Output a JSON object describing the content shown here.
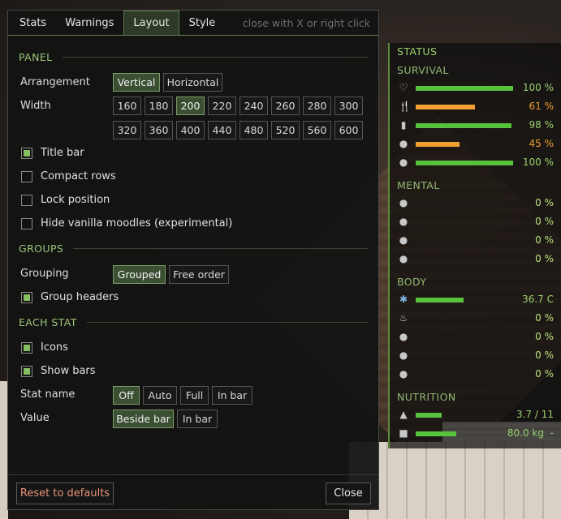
{
  "colors": {
    "accent_green": "#9bd06e",
    "bar_green": "#57c23c",
    "bar_orange": "#f0a030",
    "warn_orange": "#f0a030",
    "reset_red": "#e8937a",
    "zero_green": "#b8e07a"
  },
  "tabs": {
    "stats": "Stats",
    "warnings": "Warnings",
    "layout": "Layout",
    "style": "Style",
    "hint": "close with X or right click",
    "active": "Layout"
  },
  "panel": {
    "section": "PANEL",
    "arrangement_label": "Arrangement",
    "arrangement_options": [
      "Vertical",
      "Horizontal"
    ],
    "arrangement_selected": "Vertical",
    "width_label": "Width",
    "width_options": [
      "160",
      "180",
      "200",
      "220",
      "240",
      "260",
      "280",
      "300",
      "320",
      "360",
      "400",
      "440",
      "480",
      "520",
      "560",
      "600"
    ],
    "width_selected": "200",
    "title_bar": {
      "label": "Title bar",
      "checked": true
    },
    "compact_rows": {
      "label": "Compact rows",
      "checked": false
    },
    "lock_position": {
      "label": "Lock position",
      "checked": false
    },
    "hide_vanilla": {
      "label": "Hide vanilla moodles (experimental)",
      "checked": false
    }
  },
  "groups": {
    "section": "GROUPS",
    "grouping_label": "Grouping",
    "grouping_options": [
      "Grouped",
      "Free order"
    ],
    "grouping_selected": "Grouped",
    "group_headers": {
      "label": "Group headers",
      "checked": true
    }
  },
  "each_stat": {
    "section": "EACH STAT",
    "icons": {
      "label": "Icons",
      "checked": true
    },
    "show_bars": {
      "label": "Show bars",
      "checked": true
    },
    "stat_name_label": "Stat name",
    "stat_name_options": [
      "Off",
      "Auto",
      "Full",
      "In bar"
    ],
    "stat_name_selected": "Off",
    "value_label": "Value",
    "value_options": [
      "Beside bar",
      "In bar"
    ],
    "value_selected": "Beside bar"
  },
  "footer": {
    "reset": "Reset to defaults",
    "close": "Close"
  },
  "status": {
    "title": "STATUS",
    "survival": {
      "label": "SURVIVAL",
      "rows": [
        {
          "icon": "heart-icon",
          "glyph": "♡",
          "value": "100 %",
          "fill": 1.0,
          "color": "#57c23c",
          "text_color": "#9bd06e"
        },
        {
          "icon": "fork-knife-icon",
          "glyph": "🍴",
          "value": "61 %",
          "fill": 0.61,
          "color": "#f0a030",
          "text_color": "#f0a030"
        },
        {
          "icon": "water-glass-icon",
          "glyph": "▮",
          "value": "98 %",
          "fill": 0.98,
          "color": "#57c23c",
          "text_color": "#9bd06e"
        },
        {
          "icon": "tired-face-icon",
          "glyph": "●",
          "value": "45 %",
          "fill": 0.45,
          "color": "#f0a030",
          "text_color": "#f0a030"
        },
        {
          "icon": "brain-icon",
          "glyph": "●",
          "value": "100 %",
          "fill": 1.0,
          "color": "#57c23c",
          "text_color": "#9bd06e"
        }
      ]
    },
    "mental": {
      "label": "MENTAL",
      "rows": [
        {
          "icon": "angry-face-icon",
          "glyph": "●",
          "value": "0 %",
          "fill": 0,
          "color": "#57c23c",
          "text_color": "#b8e07a"
        },
        {
          "icon": "scared-face-icon",
          "glyph": "●",
          "value": "0 %",
          "fill": 0,
          "color": "#57c23c",
          "text_color": "#b8e07a"
        },
        {
          "icon": "bored-face-icon",
          "glyph": "●",
          "value": "0 %",
          "fill": 0,
          "color": "#57c23c",
          "text_color": "#b8e07a"
        },
        {
          "icon": "sad-face-icon",
          "glyph": "●",
          "value": "0 %",
          "fill": 0,
          "color": "#57c23c",
          "text_color": "#b8e07a"
        }
      ]
    },
    "body": {
      "label": "BODY",
      "rows": [
        {
          "icon": "snowflake-icon",
          "glyph": "✱",
          "value": "36.7 C",
          "fill": 0.49,
          "color": "#57c23c",
          "text_color": "#9bd06e"
        },
        {
          "icon": "wet-icon",
          "glyph": "♨",
          "value": "0 %",
          "fill": 0,
          "color": "#57c23c",
          "text_color": "#b8e07a"
        },
        {
          "icon": "sick-face-icon",
          "glyph": "●",
          "value": "0 %",
          "fill": 0,
          "color": "#57c23c",
          "text_color": "#b8e07a"
        },
        {
          "icon": "pain-face-icon",
          "glyph": "●",
          "value": "0 %",
          "fill": 0,
          "color": "#57c23c",
          "text_color": "#b8e07a"
        },
        {
          "icon": "zombie-face-icon",
          "glyph": "●",
          "value": "0 %",
          "fill": 0,
          "color": "#57c23c",
          "text_color": "#b8e07a"
        }
      ]
    },
    "nutrition": {
      "label": "NUTRITION",
      "rows": [
        {
          "icon": "weight-icon",
          "glyph": "▲",
          "value": "3.7 / 11",
          "fill": 0.27,
          "color": "#57c23c",
          "text_color": "#9bd06e",
          "extra": ""
        },
        {
          "icon": "scale-icon",
          "glyph": "■",
          "value": "80.0 kg",
          "fill": 0.42,
          "color": "#57c23c",
          "text_color": "#9bd06e",
          "extra": "-"
        }
      ]
    }
  }
}
